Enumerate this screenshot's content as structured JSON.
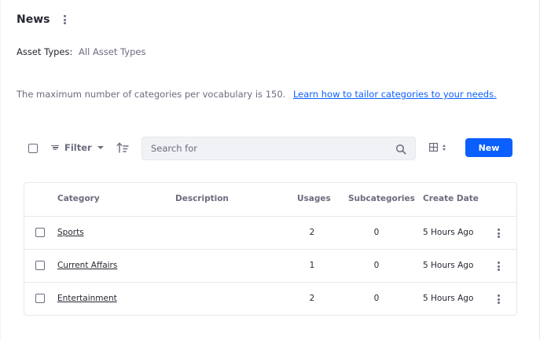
{
  "header": {
    "title": "News"
  },
  "asset_types": {
    "label": "Asset Types:",
    "value": "All Asset Types"
  },
  "info": {
    "text": "The maximum number of categories per vocabulary is 150.",
    "link_text": "Learn how to tailor categories to your needs."
  },
  "toolbar": {
    "filter_label": "Filter",
    "search_placeholder": "Search for",
    "new_label": "New"
  },
  "icons": {
    "kebab": "ellipsis-vertical-icon",
    "filter": "filter-icon",
    "sort": "order-arrow-icon",
    "search": "search-icon",
    "view": "cards-grid-icon"
  },
  "colors": {
    "accent": "#0b5fff",
    "text": "#272833",
    "muted": "#6b6c7e",
    "border": "#e7e7ed",
    "search_bg": "#f1f2f5"
  },
  "table": {
    "columns": [
      "Category",
      "Description",
      "Usages",
      "Subcategories",
      "Create Date"
    ],
    "rows": [
      {
        "category": "Sports",
        "description": "",
        "usages": "2",
        "subcategories": "0",
        "create_date": "5 Hours Ago"
      },
      {
        "category": "Current Affairs",
        "description": "",
        "usages": "1",
        "subcategories": "0",
        "create_date": "5 Hours Ago"
      },
      {
        "category": "Entertainment",
        "description": "",
        "usages": "2",
        "subcategories": "0",
        "create_date": "5 Hours Ago"
      }
    ]
  }
}
